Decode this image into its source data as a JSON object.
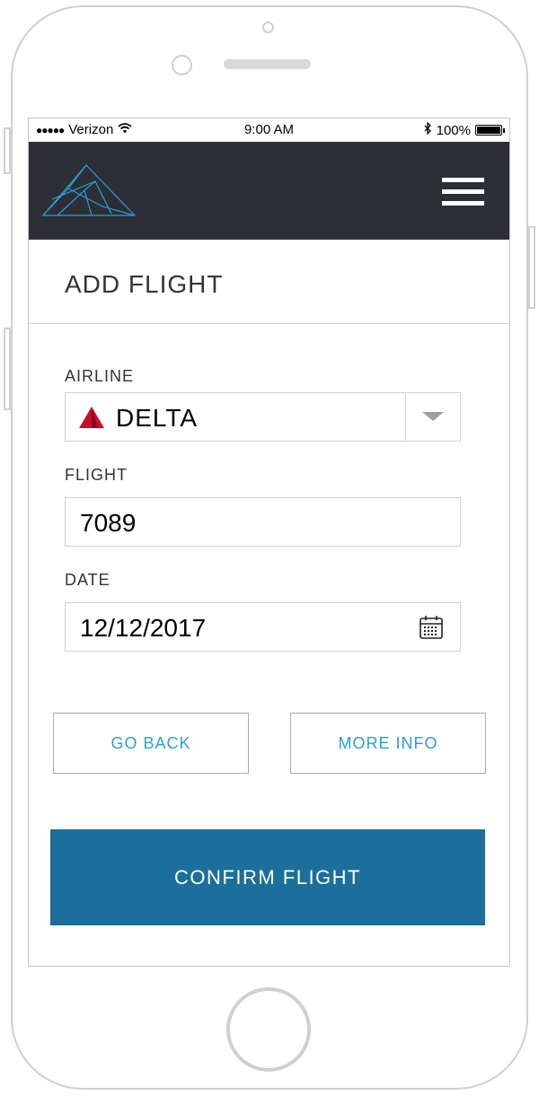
{
  "status_bar": {
    "signal_dots": "●●●●●",
    "carrier": "Verizon",
    "wifi_icon": "wifi-icon",
    "time": "9:00 AM",
    "bluetooth_icon": "bluetooth-icon",
    "battery_percent": "100%",
    "battery_level": 1.0
  },
  "header": {
    "logo_icon": "mountain-logo-icon",
    "menu_icon": "hamburger-menu-icon",
    "background_color": "#2c2f36",
    "logo_color": "#2a9fd6"
  },
  "page": {
    "title": "ADD FLIGHT"
  },
  "form": {
    "airline": {
      "label": "AIRLINE",
      "value": "DELTA",
      "logo_color": "#c8102e"
    },
    "flight": {
      "label": "FLIGHT",
      "value": "7089"
    },
    "date": {
      "label": "DATE",
      "value": "12/12/2017"
    }
  },
  "actions": {
    "go_back_label": "GO BACK",
    "more_info_label": "MORE INFO",
    "confirm_label": "CONFIRM FLIGHT",
    "accent_color": "#2a9fd6",
    "primary_color": "#1b6f9a"
  }
}
